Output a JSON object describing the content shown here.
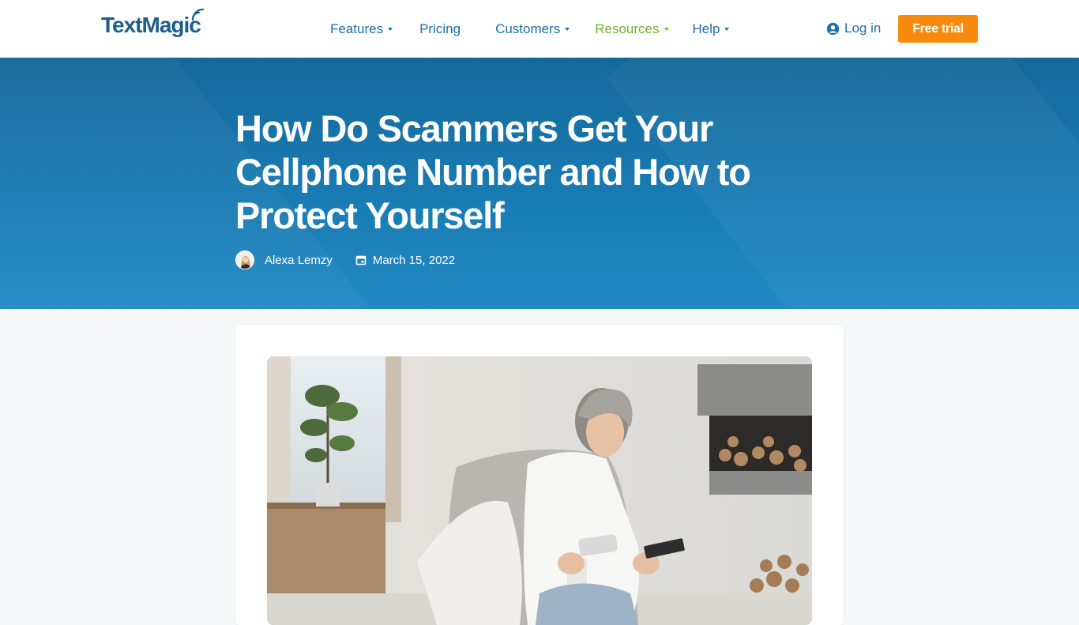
{
  "header": {
    "logo_text": "TextMagic",
    "nav": [
      {
        "label": "Features",
        "has_dropdown": true,
        "active": false
      },
      {
        "label": "Pricing",
        "has_dropdown": false,
        "active": false
      },
      {
        "label": "Customers",
        "has_dropdown": true,
        "active": false
      },
      {
        "label": "Resources",
        "has_dropdown": true,
        "active": true
      },
      {
        "label": "Help",
        "has_dropdown": true,
        "active": false
      }
    ],
    "login_label": "Log in",
    "cta_label": "Free trial"
  },
  "article": {
    "title": "How Do Scammers Get Your Cellphone Number and How to Protect Yourself",
    "author": "Alexa Lemzy",
    "date": "March 15, 2022"
  },
  "colors": {
    "brand_blue": "#1d6fa5",
    "accent_green": "#6bb52c",
    "cta_orange": "#f88b0e",
    "hero_gradient_top": "#14699b",
    "hero_gradient_bottom": "#2289c4"
  },
  "icons": {
    "login": "user-circle-icon",
    "date": "calendar-icon",
    "logo_mark": "signal-icon"
  }
}
